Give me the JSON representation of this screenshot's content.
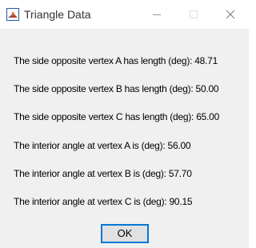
{
  "window": {
    "title": "Triangle Data",
    "icon": "matlab-icon"
  },
  "titlebar_buttons": {
    "minimize_icon": "minimize-icon",
    "maximize_icon": "maximize-icon",
    "close_icon": "close-icon"
  },
  "lines": [
    "The side opposite vertex A has length (deg): 48.71",
    "The side opposite vertex B has length (deg): 50.00",
    "The side opposite vertex C has length (deg): 65.00",
    "The interior angle at vertex A is (deg): 56.00",
    "The interior angle at vertex B is (deg): 57.70",
    "The interior angle at vertex C is (deg): 90.15"
  ],
  "buttons": {
    "ok_label": "OK"
  },
  "colors": {
    "focus_border": "#0078d7",
    "button_face": "#e1e1e1",
    "dialog_background": "#f0f0f0"
  }
}
